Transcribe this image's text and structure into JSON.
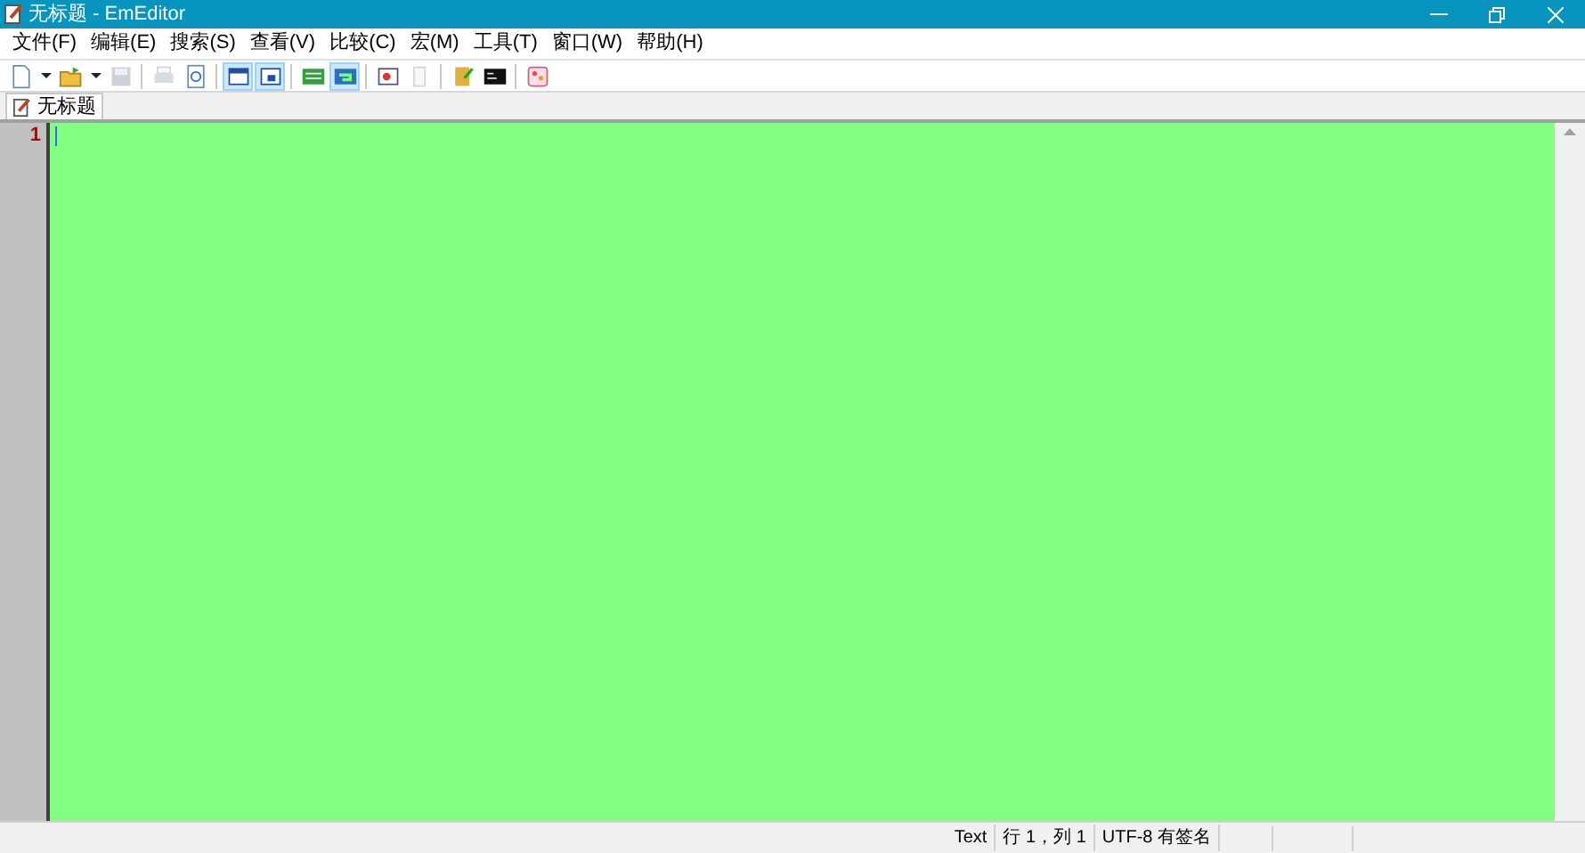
{
  "window": {
    "title": "无标题 - EmEditor"
  },
  "menu": [
    "文件(F)",
    "编辑(E)",
    "搜索(S)",
    "查看(V)",
    "比较(C)",
    "宏(M)",
    "工具(T)",
    "窗口(W)",
    "帮助(H)"
  ],
  "toolbar": [
    {
      "kind": "button",
      "selected": false,
      "disabled": false
    },
    {
      "kind": "dropdown"
    },
    {
      "kind": "button",
      "selected": false,
      "disabled": false
    },
    {
      "kind": "dropdown"
    },
    {
      "kind": "button",
      "selected": false,
      "disabled": true
    },
    {
      "kind": "separator"
    },
    {
      "kind": "button",
      "selected": false,
      "disabled": true
    },
    {
      "kind": "button",
      "selected": false,
      "disabled": false
    },
    {
      "kind": "separator"
    },
    {
      "kind": "button",
      "selected": true,
      "disabled": false
    },
    {
      "kind": "button",
      "selected": true,
      "disabled": false
    },
    {
      "kind": "separator"
    },
    {
      "kind": "button",
      "selected": false,
      "disabled": false
    },
    {
      "kind": "button",
      "selected": true,
      "disabled": false
    },
    {
      "kind": "separator"
    },
    {
      "kind": "button",
      "selected": false,
      "disabled": false
    },
    {
      "kind": "button",
      "selected": false,
      "disabled": true
    },
    {
      "kind": "separator"
    },
    {
      "kind": "button",
      "selected": false,
      "disabled": false
    },
    {
      "kind": "button",
      "selected": false,
      "disabled": false
    },
    {
      "kind": "separator"
    },
    {
      "kind": "button",
      "selected": false,
      "disabled": false
    }
  ],
  "tabs": [
    {
      "label": "无标题",
      "selected": true
    }
  ],
  "editor": {
    "line_numbers": [
      "1"
    ]
  },
  "status_bar": [
    "Text",
    "行 1，列 1",
    "UTF-8 有签名"
  ]
}
